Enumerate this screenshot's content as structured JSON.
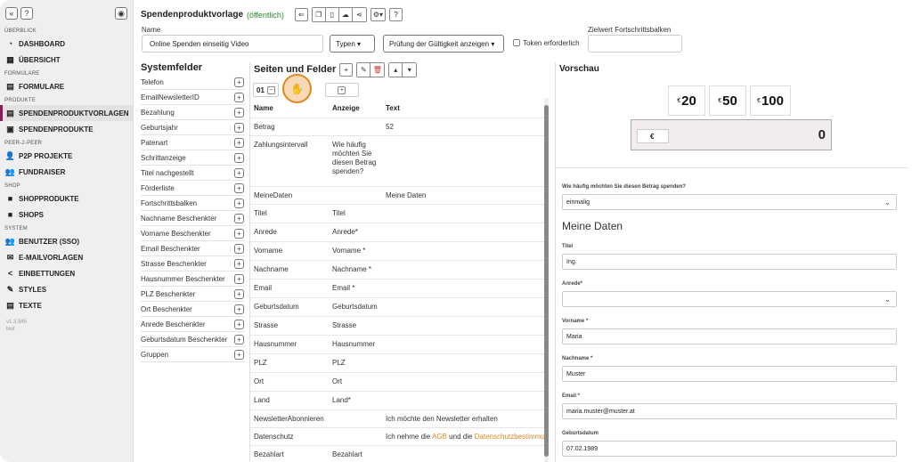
{
  "sidebar": {
    "sections": [
      {
        "label": "ÜBERBLICK"
      },
      {
        "label": "FORMULARE"
      },
      {
        "label": "PRODUKTE"
      },
      {
        "label": "PEER-2-PEER"
      },
      {
        "label": "SHOP"
      },
      {
        "label": "SYSTEM"
      }
    ],
    "items": [
      {
        "label": "DASHBOARD",
        "icon": "dashboard-icon"
      },
      {
        "label": "ÜBERSICHT",
        "icon": "overview-icon"
      },
      {
        "label": "FORMULARE",
        "icon": "form-icon"
      },
      {
        "label": "SPENDENPRODUKTVORLAGEN",
        "icon": "file-icon"
      },
      {
        "label": "SPENDENPRODUKTE",
        "icon": "product-icon"
      },
      {
        "label": "P2P PROJEKTE",
        "icon": "person-plus-icon"
      },
      {
        "label": "FUNDRAISER",
        "icon": "users-icon"
      },
      {
        "label": "SHOPPRODUKTE",
        "icon": "bag-icon"
      },
      {
        "label": "SHOPS",
        "icon": "bag-icon"
      },
      {
        "label": "BENUTZER (SSO)",
        "icon": "users-icon"
      },
      {
        "label": "E-MAILVORLAGEN",
        "icon": "mail-icon"
      },
      {
        "label": "EINBETTUNGEN",
        "icon": "share-icon"
      },
      {
        "label": "STYLES",
        "icon": "pen-icon"
      },
      {
        "label": "TEXTE",
        "icon": "doc-icon"
      }
    ],
    "version": "v1.3.945",
    "env": "test",
    "accent": "#8a1a5c"
  },
  "header": {
    "title": "Spendenproduktvorlage",
    "status": "(öffentlich)",
    "name_label": "Name",
    "name_value": "Online Spenden einseitig Video",
    "type_select": "Typen",
    "validity_select": "Prüfung der Gültigkeit anzeigen",
    "token_label": "Token erforderlich",
    "target_label": "Zielwert Fortschrittsbalken"
  },
  "systemfelder": {
    "title": "Systemfelder",
    "items": [
      "Telefon",
      "EmailNewsletterID",
      "Bezahlung",
      "Geburtsjahr",
      "Patenart",
      "Schrittanzeige",
      "Titel nachgestellt",
      "Förderliste",
      "Fortschrittsbalken",
      "Nachname Beschenkter",
      "Vorname Beschenkter",
      "Email Beschenkter",
      "Strasse Beschenkter",
      "Hausnummer Beschenkter",
      "PLZ Beschenkter",
      "Ort Beschenkter",
      "Anrede Beschenkter",
      "Geburtsdatum Beschenkter",
      "Gruppen"
    ]
  },
  "seiten": {
    "title": "Seiten und Felder",
    "page_number": "01",
    "columns": [
      "Name",
      "Anzeige",
      "Text"
    ],
    "rows": [
      {
        "name": "Betrag",
        "anzeige": "",
        "text": "52"
      },
      {
        "name": "Zahlungsintervall",
        "anzeige": "Wie häufig möchten Sie diesen Betrag spenden?",
        "text": ""
      },
      {
        "name": "MeineDaten",
        "anzeige": "",
        "text": "Meine Daten"
      },
      {
        "name": "Titel",
        "anzeige": "Titel",
        "text": ""
      },
      {
        "name": "Anrede",
        "anzeige": "Anrede*",
        "text": ""
      },
      {
        "name": "Vorname",
        "anzeige": "Vorname *",
        "text": ""
      },
      {
        "name": "Nachname",
        "anzeige": "Nachname *",
        "text": ""
      },
      {
        "name": "Email",
        "anzeige": "Email *",
        "text": ""
      },
      {
        "name": "Geburtsdatum",
        "anzeige": "Geburtsdatum",
        "text": ""
      },
      {
        "name": "Strasse",
        "anzeige": "Strasse",
        "text": ""
      },
      {
        "name": "Hausnummer",
        "anzeige": "Hausnummer",
        "text": ""
      },
      {
        "name": "PLZ",
        "anzeige": "PLZ",
        "text": ""
      },
      {
        "name": "Ort",
        "anzeige": "Ort",
        "text": ""
      },
      {
        "name": "Land",
        "anzeige": "Land*",
        "text": ""
      },
      {
        "name": "NewsletterAbonnieren",
        "anzeige": "",
        "text": "Ich möchte den Newsletter erhalten"
      },
      {
        "name": "Datenschutz",
        "anzeige": "",
        "text": ""
      },
      {
        "name": "Bezahlart",
        "anzeige": "Bezahlart",
        "text": ""
      }
    ],
    "datenschutz_text": {
      "pre": "Ich nehme die ",
      "agb": "AGB",
      "mid": " und die ",
      "ds": "Datenschutzbestimmungen"
    }
  },
  "vorschau": {
    "title": "Vorschau",
    "currency": "€",
    "amounts": [
      "20",
      "50",
      "100"
    ],
    "amount_value": "0",
    "intervall_label": "Wie häufig möchten Sie diesen Betrag spenden?",
    "intervall_value": "einmalig",
    "section_title": "Meine Daten",
    "fields": [
      {
        "label": "Titel",
        "value": "Ing."
      },
      {
        "label": "Anrede*",
        "value": ""
      },
      {
        "label": "Vorname *",
        "value": "Maria"
      },
      {
        "label": "Nachname *",
        "value": "Muster"
      },
      {
        "label": "Email *",
        "value": "maria.muster@muster.at"
      },
      {
        "label": "Geburtsdatum",
        "value": "07.02.1989"
      }
    ]
  }
}
